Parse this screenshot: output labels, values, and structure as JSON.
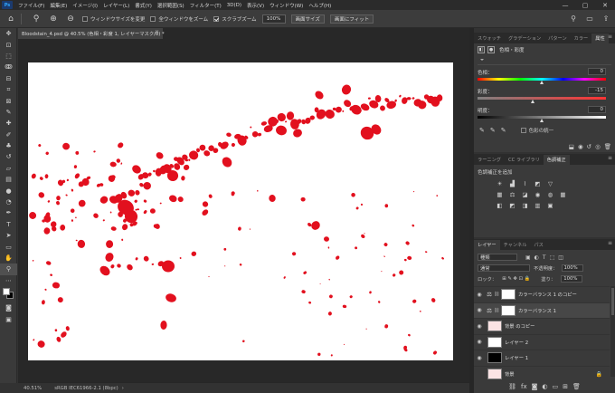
{
  "app": {
    "logo": "Ps"
  },
  "menu": [
    "ファイル(F)",
    "編集(E)",
    "イメージ(I)",
    "レイヤー(L)",
    "書式(Y)",
    "選択範囲(S)",
    "フィルター(T)",
    "3D(D)",
    "表示(V)",
    "ウィンドウ(W)",
    "ヘルプ(H)"
  ],
  "window_controls": {
    "minimize": "—",
    "maximize": "▢",
    "close": "✕"
  },
  "options": {
    "resize_windows": "ウィンドウサイズを変更",
    "zoom_all": "全ウィンドウをズーム",
    "scrubby_zoom": "スクラブズーム",
    "scrubby_zoom_checked": true,
    "zoom_value": "100%",
    "fit_screen": "画面サイズ",
    "fill_screen": "画面にフィット"
  },
  "document": {
    "tab_title": "Bloodstain_4.psd @ 40.5% (色相・彩度 1, レイヤーマスク/8) *",
    "zoom_status": "40.51%",
    "profile_status": "sRGB IEC61966-2.1 (8bpc)",
    "splatter_color": "#e2101e"
  },
  "panels": {
    "top_tabs": [
      "スウォッチ",
      "グラデーション",
      "パターン",
      "カラー",
      "属性"
    ],
    "properties": {
      "title": "色相・彩度",
      "hue_label": "色相：",
      "hue_value": "0",
      "hue_pos": 0.5,
      "sat_label": "彩度：",
      "sat_value": "-15",
      "sat_pos": 0.43,
      "light_label": "明度：",
      "light_value": "0",
      "light_pos": 0.5,
      "colorize_label": "色彩の統一"
    },
    "mid_tabs": [
      "ラーニング",
      "CC ライブラリ",
      "色調補正"
    ],
    "adjustments_title": "色調補正を追加",
    "layer_tabs": [
      "レイヤー",
      "チャンネル",
      "パス"
    ],
    "layers": {
      "filter_kind": "種類",
      "blend_mode": "通常",
      "opacity_label": "不透明度：",
      "opacity_value": "100%",
      "lock_label": "ロック：",
      "fill_label": "塗り：",
      "fill_value": "100%",
      "items": [
        {
          "name": "カラーバランス 1 のコピー",
          "kind": "adjustment",
          "visible": true,
          "thumb": "#ffffff"
        },
        {
          "name": "カラーバランス 1",
          "kind": "adjustment",
          "visible": true,
          "thumb": "#ffffff"
        },
        {
          "name": "背景 のコピー",
          "kind": "pixel",
          "visible": true,
          "thumb": "#fbe3e4"
        },
        {
          "name": "レイヤー 2",
          "kind": "pixel",
          "visible": true,
          "thumb": "#ffffff"
        },
        {
          "name": "レイヤー 1",
          "kind": "pixel",
          "visible": true,
          "thumb": "#000000"
        },
        {
          "name": "背景",
          "kind": "pixel",
          "visible": false,
          "thumb": "#fbe3e4",
          "locked": true
        }
      ]
    }
  },
  "colors": {
    "accent": "#31a8ff",
    "foreground_swatch": "#ffffff",
    "background_swatch": "#000000"
  }
}
